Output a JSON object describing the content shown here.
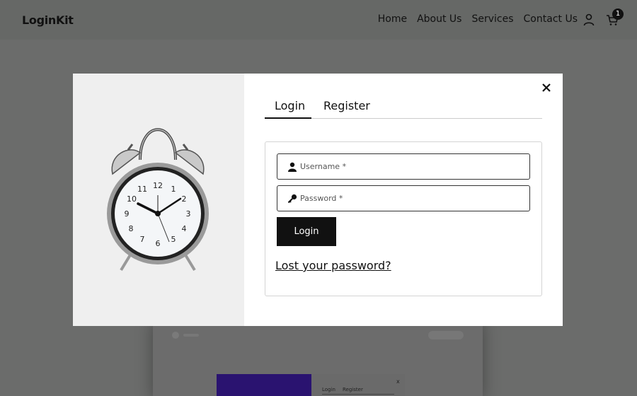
{
  "header": {
    "logo": "LoginKit",
    "nav": [
      "Home",
      "About Us",
      "Services",
      "Contact Us"
    ],
    "cart_count": "1"
  },
  "background": {
    "mini_tabs": [
      "Login",
      "Register"
    ],
    "mini_close": "x"
  },
  "modal": {
    "close": "×",
    "tabs": [
      "Login",
      "Register"
    ],
    "username_placeholder": "Username *",
    "password_placeholder": "Password *",
    "login_button": "Login",
    "lost_password": "Lost your password?"
  },
  "colors": {
    "accent": "#111111",
    "overlay": "#6b6c6b"
  }
}
